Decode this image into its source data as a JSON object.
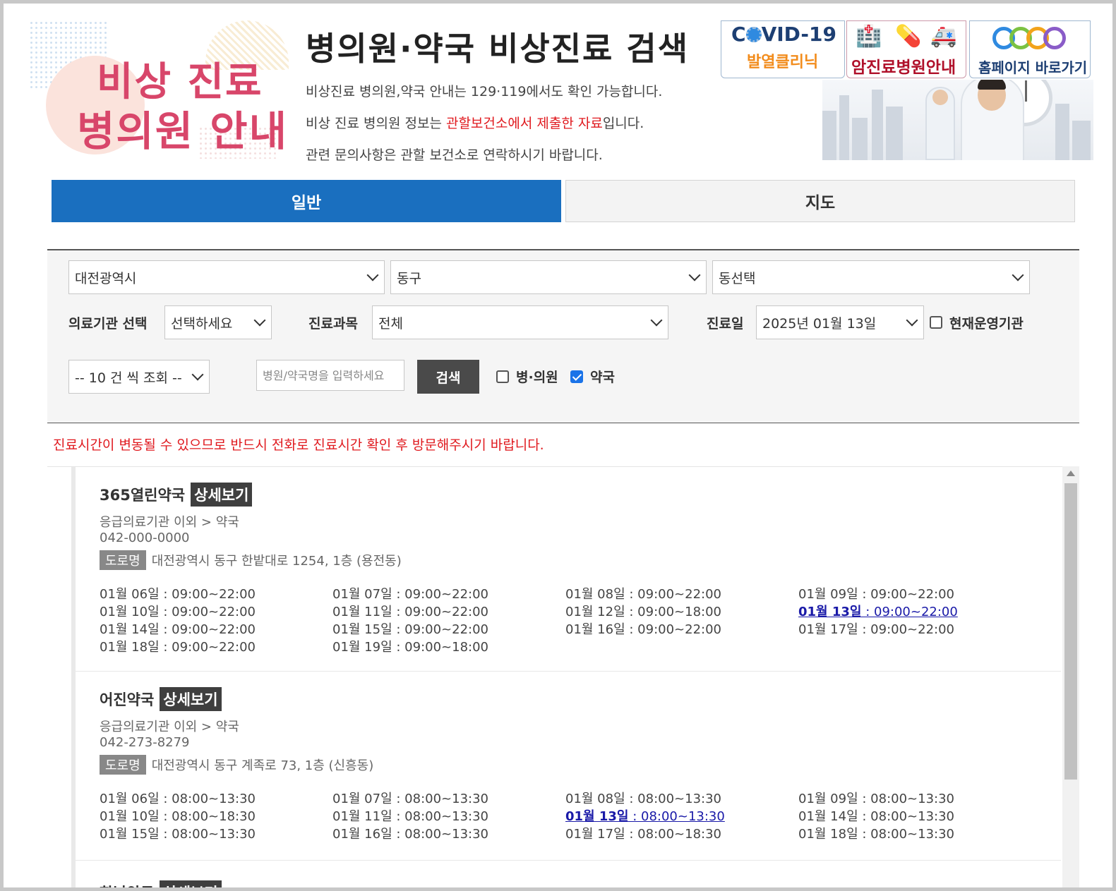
{
  "header": {
    "logo_line1": "비상 진료",
    "logo_line2": "병의원 안내",
    "title": "병의원·약국 비상진료 검색",
    "info1": "비상진료 병의원,약국 안내는 129·119에서도 확인 가능합니다.",
    "info2_pre": "비상 진료 병의원 정보는 ",
    "info2_red": "관할보건소에서 제출한 자료",
    "info2_post": "입니다.",
    "info3": "관련 문의사항은 관할 보건소로 연락하시기 바랍니다."
  },
  "banners": {
    "covid_pre": "C",
    "covid_post": "VID-19",
    "covid_sub": "발열클리닉",
    "cancer": "암진료병원안내",
    "homepage": "홈페이지 바로가기"
  },
  "tabs": {
    "general": "일반",
    "map": "지도"
  },
  "search": {
    "city": "대전광역시",
    "district": "동구",
    "dong": "동선택",
    "inst_label": "의료기관 선택",
    "inst_value": "선택하세요",
    "dept_label": "진료과목",
    "dept_value": "전체",
    "date_label": "진료일",
    "date_value": "2025년 01월 13일",
    "current_label": "현재운영기관",
    "page_size": "-- 10 건 씩 조회 --",
    "name_placeholder": "병원/약국명을 입력하세요",
    "search_button": "검색",
    "hospital_label": "병·의원",
    "pharmacy_label": "약국"
  },
  "notice": "진료시간이 변동될 수 있으므로 반드시 전화로 진료시간 확인 후 방문해주시기 바랍니다.",
  "results": [
    {
      "name": "365열린약국",
      "detail": "상세보기",
      "category": "응급의료기관 이외 > 약국",
      "tel": "042-000-0000",
      "road_label": "도로명",
      "address": "대전광역시 동구 한밭대로 1254, 1층 (용전동)",
      "schedule": [
        {
          "day": "01월 06일",
          "time": " : 09:00~22:00"
        },
        {
          "day": "01월 07일",
          "time": " : 09:00~22:00"
        },
        {
          "day": "01월 08일",
          "time": " : 09:00~22:00"
        },
        {
          "day": "01월 09일",
          "time": " : 09:00~22:00"
        },
        {
          "day": "01월 10일",
          "time": " : 09:00~22:00"
        },
        {
          "day": "01월 11일",
          "time": " : 09:00~22:00"
        },
        {
          "day": "01월 12일",
          "time": " : 09:00~18:00"
        },
        {
          "day": "01월 13일",
          "time": " : 09:00~22:00",
          "today": true
        },
        {
          "day": "01월 14일",
          "time": " : 09:00~22:00"
        },
        {
          "day": "01월 15일",
          "time": " : 09:00~22:00"
        },
        {
          "day": "01월 16일",
          "time": " : 09:00~22:00"
        },
        {
          "day": "01월 17일",
          "time": " : 09:00~22:00"
        },
        {
          "day": "01월 18일",
          "time": " : 09:00~22:00"
        },
        {
          "day": "01월 19일",
          "time": " : 09:00~18:00"
        }
      ]
    },
    {
      "name": "어진약국",
      "detail": "상세보기",
      "category": "응급의료기관 이외 > 약국",
      "tel": "042-273-8279",
      "road_label": "도로명",
      "address": "대전광역시 동구 계족로 73, 1층 (신흥동)",
      "schedule": [
        {
          "day": "01월 06일",
          "time": " : 08:00~13:30"
        },
        {
          "day": "01월 07일",
          "time": " : 08:00~13:30"
        },
        {
          "day": "01월 08일",
          "time": " : 08:00~13:30"
        },
        {
          "day": "01월 09일",
          "time": " : 08:00~13:30"
        },
        {
          "day": "01월 10일",
          "time": " : 08:00~18:30"
        },
        {
          "day": "01월 11일",
          "time": " : 08:00~13:30"
        },
        {
          "day": "01월 13일",
          "time": " : 08:00~13:30",
          "today": true
        },
        {
          "day": "01월 14일",
          "time": " : 08:00~13:30"
        },
        {
          "day": "01월 15일",
          "time": " : 08:00~13:30"
        },
        {
          "day": "01월 16일",
          "time": " : 08:00~13:30"
        },
        {
          "day": "01월 17일",
          "time": " : 08:00~18:30"
        },
        {
          "day": "01월 18일",
          "time": " : 08:00~13:30"
        }
      ]
    },
    {
      "name": "한남약국",
      "detail": "상세보기"
    }
  ],
  "colors": {
    "primary": "#1a6fbf",
    "alert": "#e0191e",
    "logo": "#d8466a",
    "today_link": "#1a1aa8"
  }
}
